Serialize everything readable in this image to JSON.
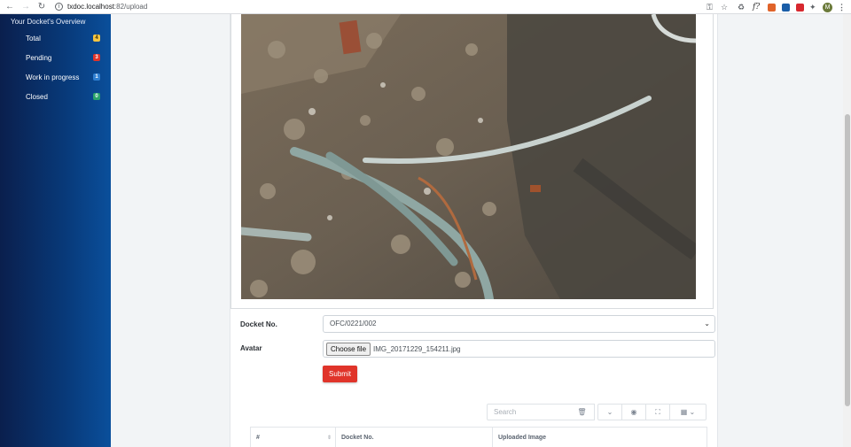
{
  "browser": {
    "url_host": "txdoc.localhost",
    "url_path": ":82/upload",
    "avatar_letter": "M"
  },
  "sidebar": {
    "heading": "Your Docket's Overview",
    "items": [
      {
        "label": "Total",
        "count": "4",
        "color": "#f5c542"
      },
      {
        "label": "Pending",
        "count": "3",
        "color": "#e0342a"
      },
      {
        "label": "Work in progress",
        "count": "1",
        "color": "#2f7fd1"
      },
      {
        "label": "Closed",
        "count": "0",
        "color": "#2aa46b"
      }
    ]
  },
  "form": {
    "docket_label": "Docket No.",
    "docket_value": "OFC/0221/002",
    "avatar_label": "Avatar",
    "choose_file_label": "Choose file",
    "file_name": "IMG_20171229_154211.jpg",
    "submit_label": "Submit"
  },
  "table": {
    "search_placeholder": "Search",
    "columns": [
      "#",
      "Docket No.",
      "Uploaded Image"
    ]
  },
  "photo": {
    "description_icon": "excavation-photo"
  }
}
